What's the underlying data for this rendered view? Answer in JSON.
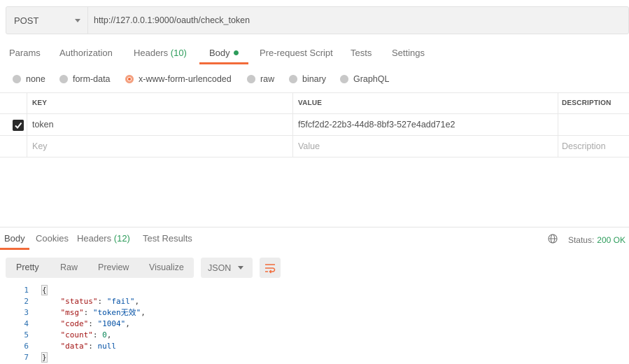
{
  "request": {
    "method": "POST",
    "url": "http://127.0.0.1:9000/oauth/check_token"
  },
  "request_tabs": [
    {
      "label": "Params"
    },
    {
      "label": "Authorization"
    },
    {
      "label": "Headers",
      "count": "(10)"
    },
    {
      "label": "Body",
      "active": true
    },
    {
      "label": "Pre-request Script"
    },
    {
      "label": "Tests"
    },
    {
      "label": "Settings"
    }
  ],
  "body_types": [
    {
      "label": "none"
    },
    {
      "label": "form-data"
    },
    {
      "label": "x-www-form-urlencoded",
      "selected": true
    },
    {
      "label": "raw"
    },
    {
      "label": "binary"
    },
    {
      "label": "GraphQL"
    }
  ],
  "params_table": {
    "headers": {
      "key": "KEY",
      "value": "VALUE",
      "description": "DESCRIPTION"
    },
    "rows": [
      {
        "checked": true,
        "key": "token",
        "value": "f5fcf2d2-22b3-44d8-8bf3-527e4add71e2",
        "description": ""
      }
    ],
    "placeholder": {
      "key": "Key",
      "value": "Value",
      "description": "Description"
    }
  },
  "response_tabs": [
    {
      "label": "Body",
      "active": true
    },
    {
      "label": "Cookies"
    },
    {
      "label": "Headers",
      "count": "(12)"
    },
    {
      "label": "Test Results"
    }
  ],
  "status": {
    "label": "Status:",
    "value": "200 OK"
  },
  "view_modes": [
    "Pretty",
    "Raw",
    "Preview",
    "Visualize"
  ],
  "format": "JSON",
  "response_body": {
    "line_numbers": [
      "1",
      "2",
      "3",
      "4",
      "5",
      "6",
      "7"
    ],
    "open_brace": "{",
    "close_brace": "}",
    "fields": [
      {
        "key": "\"status\"",
        "value": "\"fail\"",
        "kind": "str",
        "comma": ","
      },
      {
        "key": "\"msg\"",
        "value": "\"token无效\"",
        "kind": "str",
        "comma": ","
      },
      {
        "key": "\"code\"",
        "value": "\"1004\"",
        "kind": "str",
        "comma": ","
      },
      {
        "key": "\"count\"",
        "value": "0",
        "kind": "num",
        "comma": ","
      },
      {
        "key": "\"data\"",
        "value": "null",
        "kind": "kw",
        "comma": ""
      }
    ]
  },
  "colors": {
    "accent": "#f26b3a",
    "success": "#2d9c5b"
  }
}
